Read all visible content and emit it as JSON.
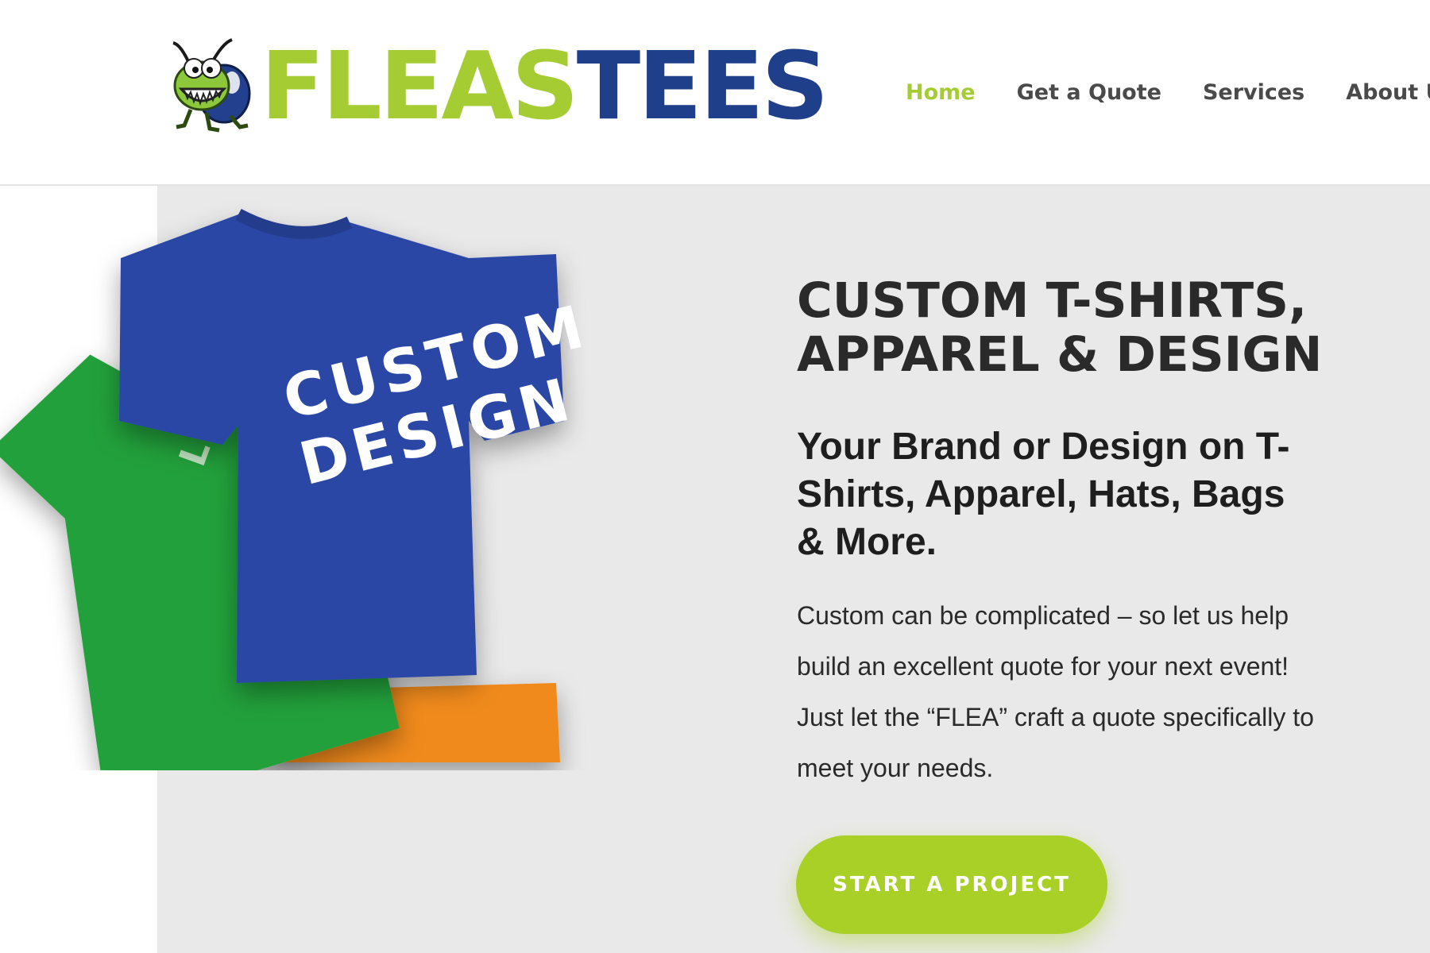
{
  "brand": {
    "name_part1": "FLEAS",
    "name_part2": "TEES",
    "mascot_icon": "flea-mascot-icon",
    "colors": {
      "green": "#a6cc34",
      "navy": "#1f3f8a"
    }
  },
  "nav": {
    "items": [
      {
        "label": "Home",
        "active": true
      },
      {
        "label": "Get a Quote",
        "active": false
      },
      {
        "label": "Services",
        "active": false
      },
      {
        "label": "About Us",
        "active": false
      }
    ],
    "active_color": "#a6cc34"
  },
  "hero": {
    "title": "CUSTOM T-SHIRTS, APPAREL & DESIGN",
    "subtitle": "Your Brand or Design on T-Shirts, Apparel, Hats, Bags & More.",
    "body": "Custom can be complicated – so let us help build an excellent quote for your next event! Just let the “FLEA” craft a quote specifically to meet your needs.",
    "cta_label": "START A PROJECT",
    "cta_color": "#a8d027",
    "image": {
      "front_shirt_text_line1": "CUSTOM",
      "front_shirt_text_line2": "DESIGN",
      "front_shirt_color": "#2a47a6",
      "back_shirt_color": "#22a03a",
      "bottom_shirt_color": "#f08a1e"
    }
  }
}
